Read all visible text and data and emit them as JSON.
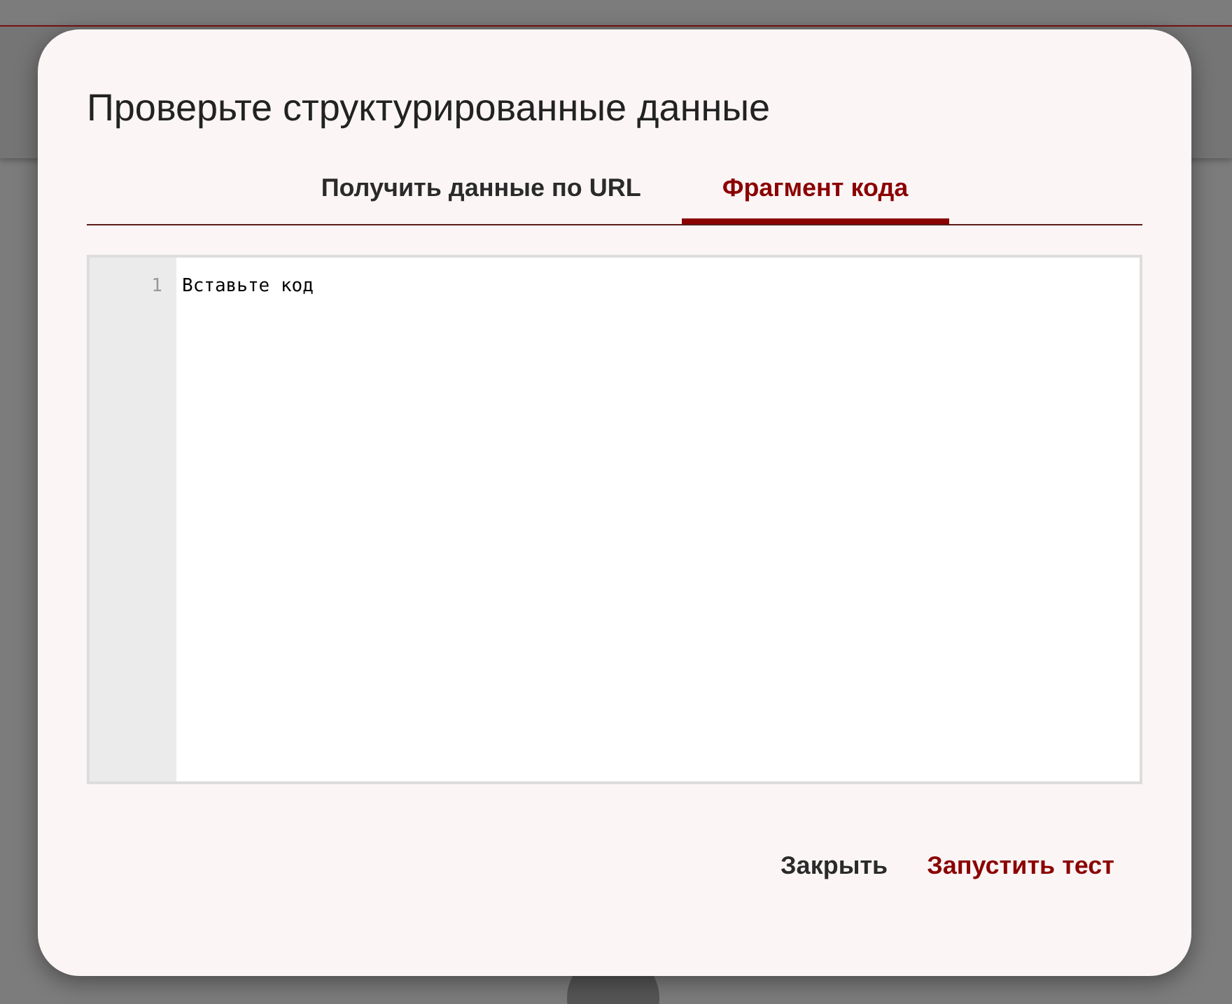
{
  "dialog": {
    "title": "Проверьте структурированные данные",
    "tabs": [
      {
        "label": "Получить данные по URL",
        "selected": false
      },
      {
        "label": "Фрагмент кода",
        "selected": true
      }
    ],
    "editor": {
      "line_numbers": [
        "1"
      ],
      "placeholder": "Вставьте код"
    },
    "buttons": [
      {
        "label": "Закрыть",
        "kind": "secondary"
      },
      {
        "label": "Запустить тест",
        "kind": "primary"
      }
    ]
  }
}
